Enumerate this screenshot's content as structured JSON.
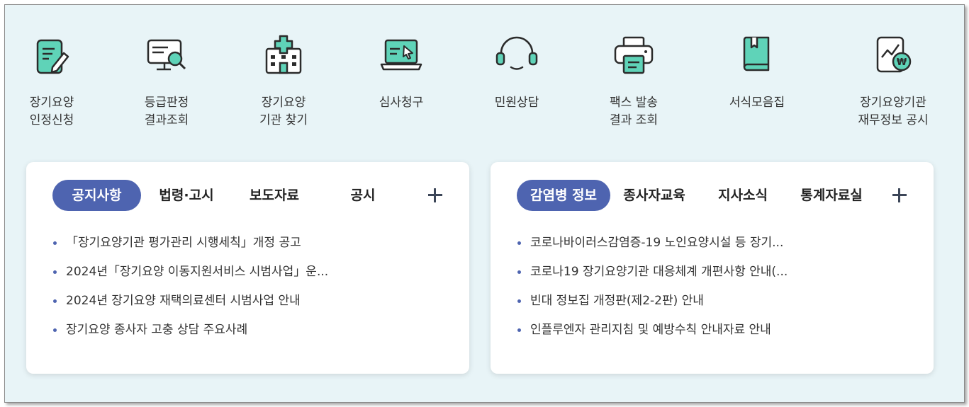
{
  "quick_menu": {
    "items": [
      {
        "label": "장기요양\n인정신청",
        "icon": "application-form-icon"
      },
      {
        "label": "등급판정\n결과조회",
        "icon": "monitor-search-icon"
      },
      {
        "label": "장기요양\n기관 찾기",
        "icon": "hospital-icon"
      },
      {
        "label": "심사청구",
        "icon": "laptop-cursor-icon"
      },
      {
        "label": "민원상담",
        "icon": "headset-icon"
      },
      {
        "label": "팩스 발송\n결과 조회",
        "icon": "fax-printer-icon"
      },
      {
        "label": "서식모음집",
        "icon": "book-icon"
      },
      {
        "label": "장기요양기관\n재무정보 공시",
        "icon": "finance-chart-won-icon"
      }
    ]
  },
  "boards": {
    "left": {
      "tabs": [
        "공지사항",
        "법령·고시",
        "보도자료",
        "공시"
      ],
      "active_tab": "공지사항",
      "items": [
        "「장기요양기관 평가관리 시행세칙」개정 공고",
        "2024년「장기요양 이동지원서비스 시범사업」운...",
        "2024년 장기요양 재택의료센터 시범사업 안내",
        "장기요양 종사자 고충 상담 주요사례"
      ]
    },
    "right": {
      "tabs": [
        "감염병 정보",
        "종사자교육",
        "지사소식",
        "통계자료실"
      ],
      "active_tab": "감염병 정보",
      "items": [
        "코로나바이러스감염증-19 노인요양시설 등 장기...",
        "코로나19 장기요양기관 대응체계 개편사항 안내(...",
        "빈대 정보집 개정판(제2-2판) 안내",
        "인플루엔자 관리지침 및 예방수칙 안내자료 안내"
      ]
    }
  },
  "colors": {
    "background": "#e8f4f7",
    "accent": "#4e64b0",
    "icon_fill": "#5fd3b8",
    "icon_stroke": "#2b2b2b"
  }
}
